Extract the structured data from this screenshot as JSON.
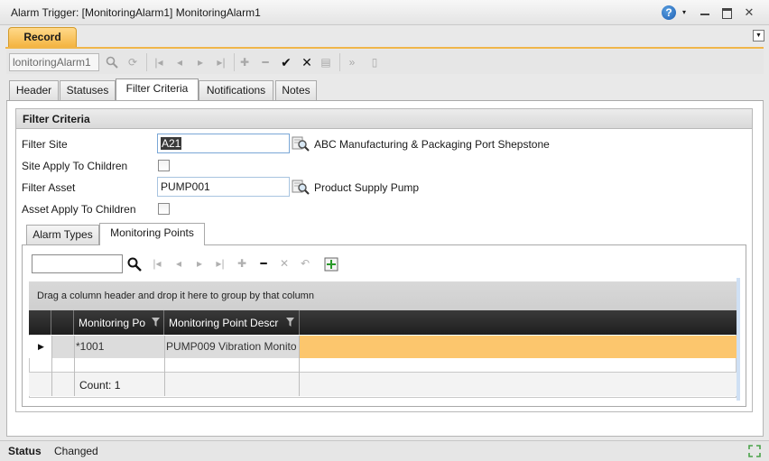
{
  "window": {
    "title": "Alarm Trigger: [MonitoringAlarm1] MonitoringAlarm1",
    "help_glyph": "?",
    "dropdown_glyph": "▾",
    "close_glyph": "✕"
  },
  "record_tab": {
    "label": "Record"
  },
  "toolbar": {
    "record_field_value": "lonitoringAlarm1",
    "buttons": [
      "search-icon",
      "refresh-icon",
      "first-icon",
      "previous-icon",
      "next-icon",
      "last-icon",
      "add-icon",
      "remove-icon",
      "accept-icon",
      "cancel-icon",
      "copy-icon",
      "expand-icon",
      "notes-icon"
    ]
  },
  "tabs": [
    {
      "label": "Header"
    },
    {
      "label": "Statuses"
    },
    {
      "label": "Filter Criteria",
      "active": true
    },
    {
      "label": "Notifications"
    },
    {
      "label": "Notes"
    }
  ],
  "filter_criteria": {
    "title": "Filter Criteria",
    "filter_site_label": "Filter Site",
    "filter_site_value": "A21",
    "filter_site_description": "ABC Manufacturing & Packaging Port Shepstone",
    "site_apply_label": "Site Apply To Children",
    "site_apply_checked": false,
    "filter_asset_label": "Filter Asset",
    "filter_asset_value": "PUMP001",
    "filter_asset_description": "Product Supply Pump",
    "asset_apply_label": "Asset Apply To Children",
    "asset_apply_checked": false
  },
  "inner_tabs": [
    {
      "label": "Alarm Types"
    },
    {
      "label": "Monitoring Points",
      "active": true
    }
  ],
  "grid": {
    "search_value": "",
    "group_panel_text": "Drag a column header and drop it here to group by that column",
    "columns": [
      "Monitoring Po",
      "Monitoring Point Descr"
    ],
    "rows": [
      {
        "indicator": "▶",
        "cells": [
          "*1001",
          "PUMP009 Vibration Monito"
        ]
      }
    ],
    "footer_count": "Count: 1"
  },
  "status": {
    "label": "Status",
    "value": "Changed"
  },
  "colors": {
    "accent_orange": "#f4b441",
    "selected_row": "#fcc66d",
    "grid_header": "#1e1e1e"
  }
}
